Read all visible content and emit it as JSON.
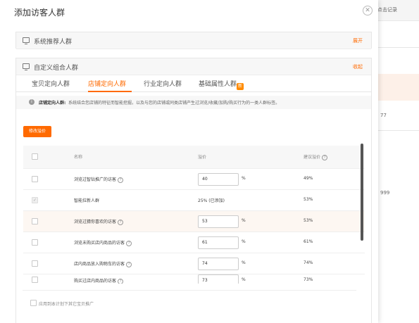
{
  "background": {
    "link": "点击记录",
    "number_1": "77",
    "number_2": "999"
  },
  "modal": {
    "title": "添加访客人群",
    "close_icon": "close-icon",
    "system_panel": {
      "title": "系统推荐人群",
      "action": "展开",
      "icon": "monitor-icon"
    },
    "custom_panel": {
      "title": "自定义组合人群",
      "action": "收起",
      "icon": "monitor-icon"
    },
    "tabs": [
      {
        "label": "宝贝定向人群"
      },
      {
        "label": "店铺定向人群",
        "active": true
      },
      {
        "label": "行业定向人群"
      },
      {
        "label": "基础属性人群",
        "badge": "新"
      }
    ],
    "info": {
      "title": "店铺定向人群:",
      "text": "系统结合您店铺的特征而智能挖掘，以及与您的店铺或同类店铺产生过浏览/收藏/加购/购买行为的一类人群标签。"
    },
    "modify_bid_button": "修改溢价",
    "table": {
      "headers": {
        "name": "名称",
        "bid": "溢价",
        "suggested": "建议溢价"
      },
      "rows": [
        {
          "name": "浏览过智钻推广的访客",
          "bid": "40",
          "unit": "%",
          "suggested": "49%",
          "editable": true
        },
        {
          "name": "智能拉新人群",
          "bid_text": "25% (已添加)",
          "suggested": "53%",
          "editable": false
        },
        {
          "name": "浏览过猜你喜欢的访客",
          "bid": "53",
          "unit": "%",
          "suggested": "53%",
          "editable": true,
          "highlight": true
        },
        {
          "name": "浏览未购买店内商品的访客",
          "bid": "61",
          "unit": "%",
          "suggested": "61%",
          "editable": true
        },
        {
          "name": "店内商品放入购物车的访客",
          "bid": "74",
          "unit": "%",
          "suggested": "74%",
          "editable": true
        },
        {
          "name": "购买过店内商品的访客",
          "bid": "73",
          "unit": "%",
          "suggested": "73%",
          "editable": true
        }
      ]
    },
    "footer_checkbox": "应用到本计划下其它宝贝推广"
  },
  "colors": {
    "accent": "#ff6a00"
  }
}
